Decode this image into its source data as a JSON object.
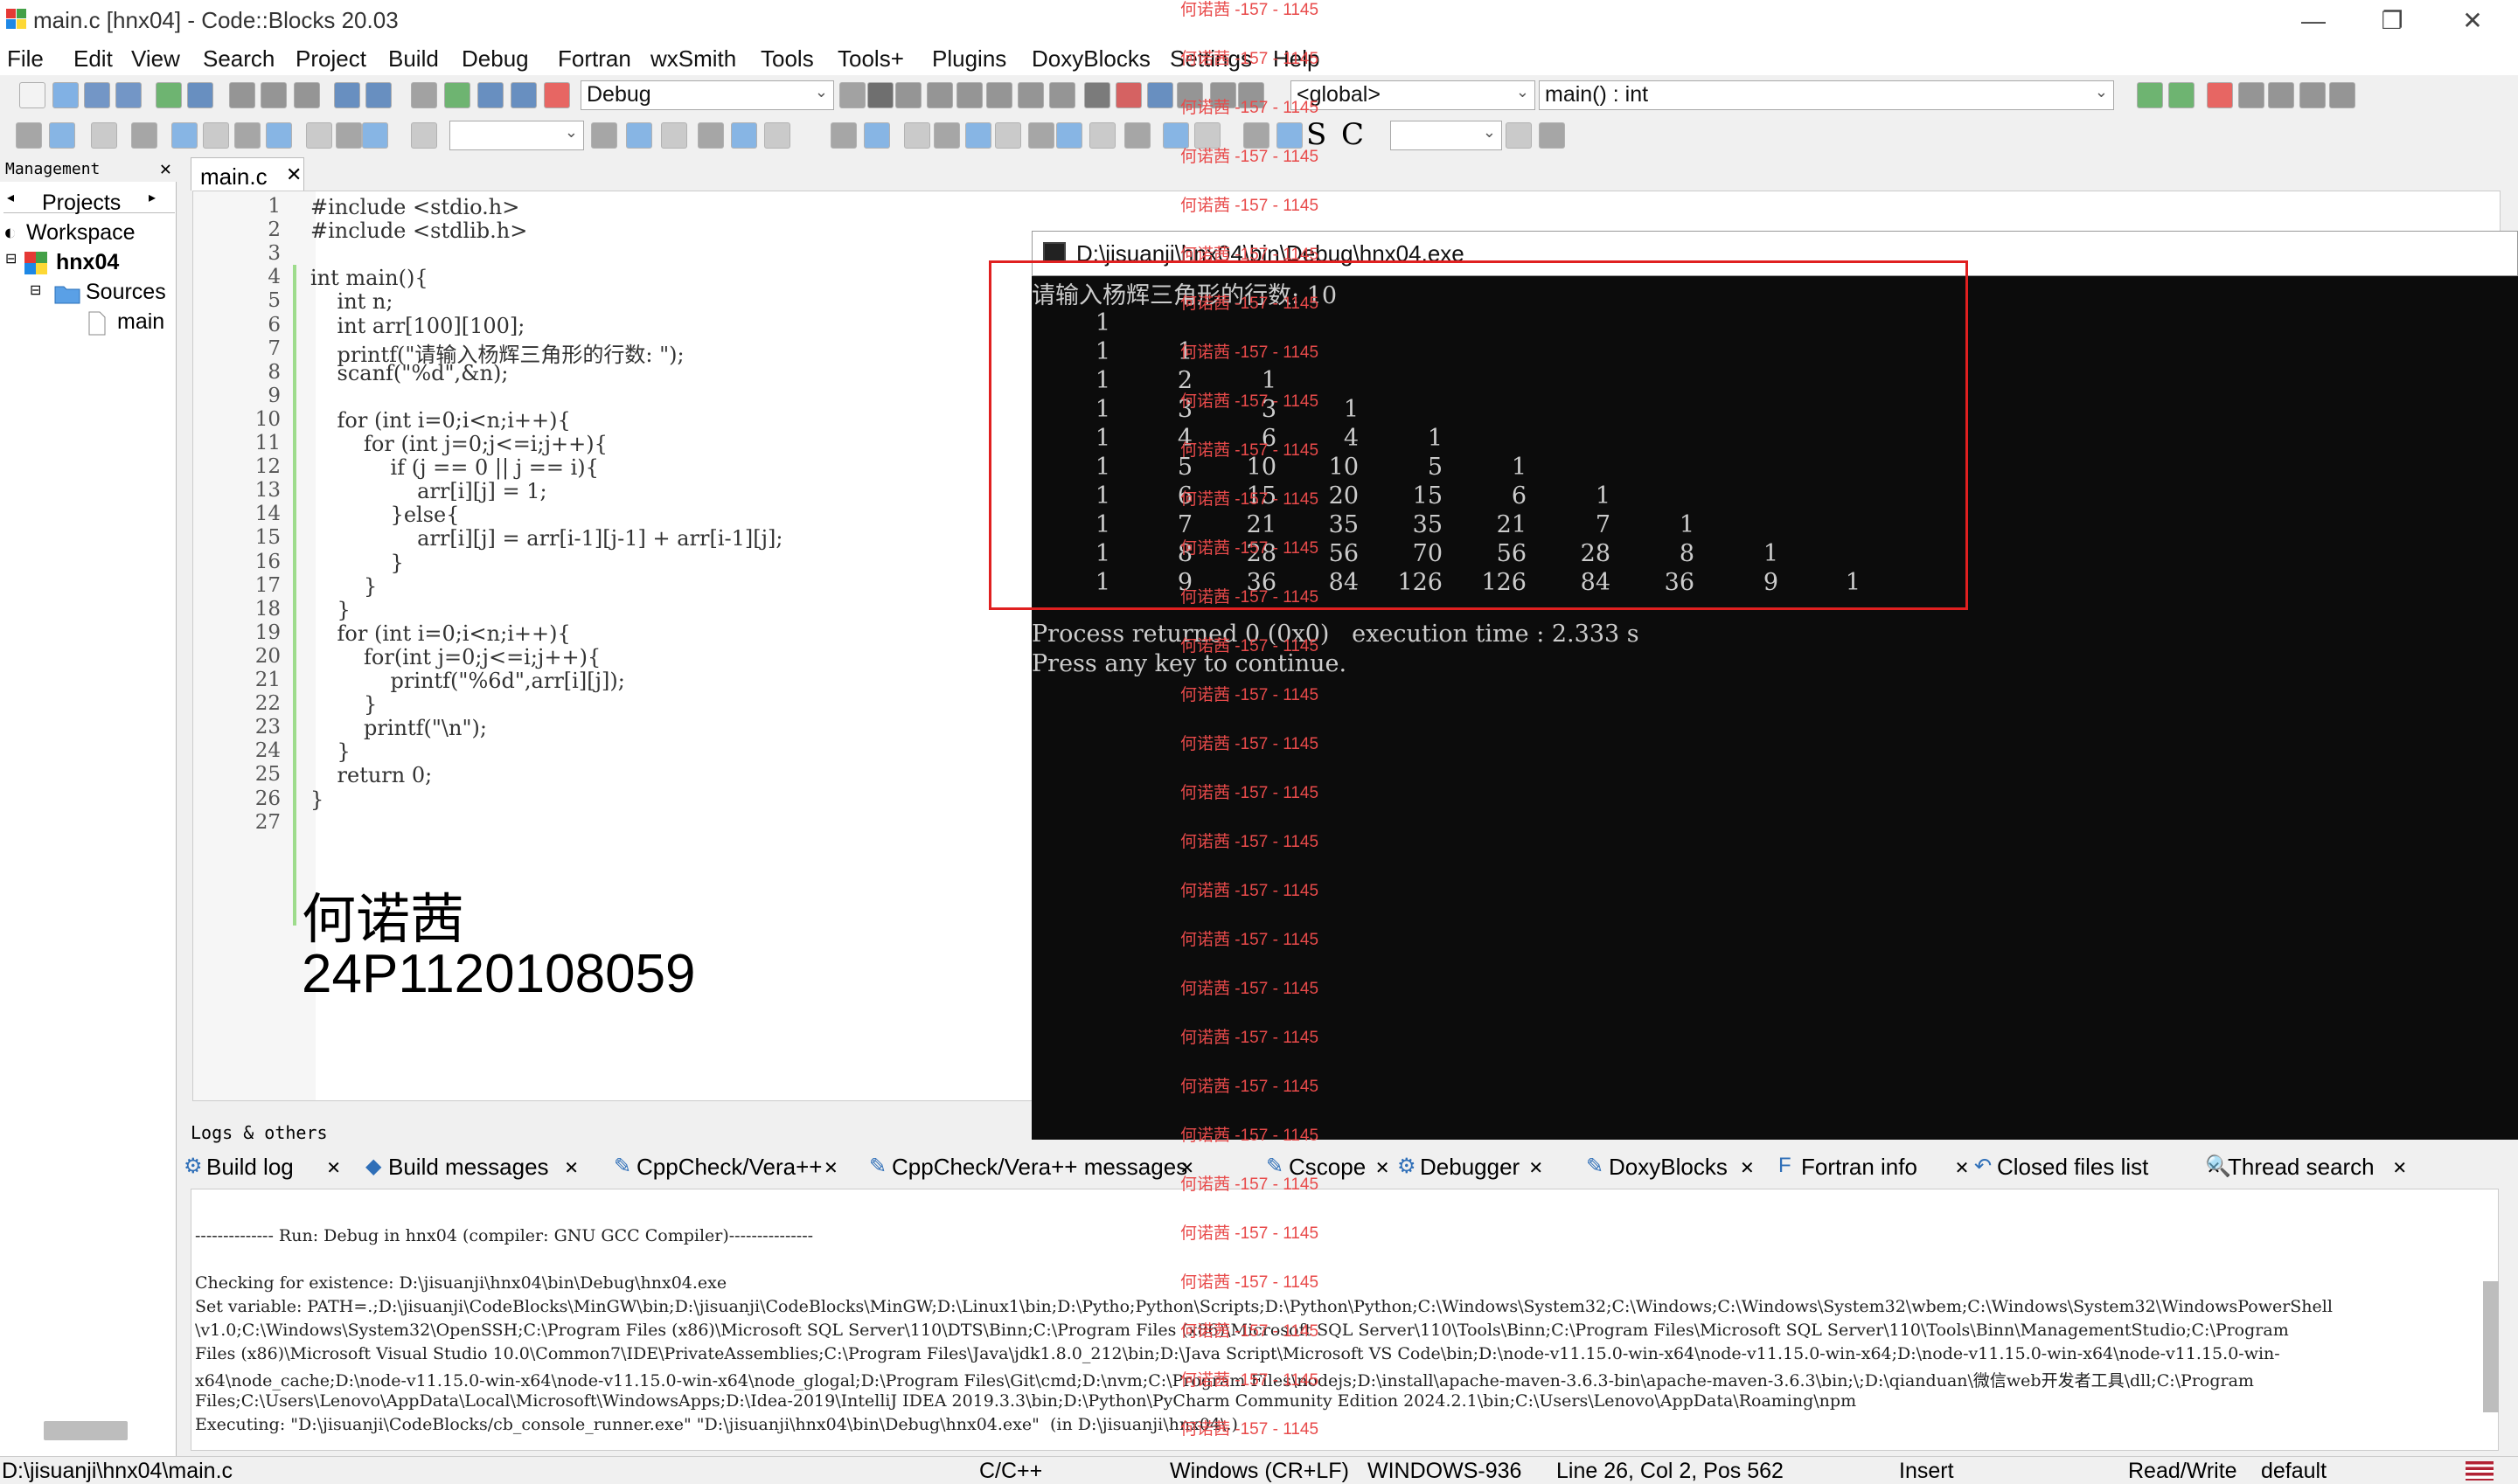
{
  "window": {
    "title": "main.c [hnx04] - Code::Blocks 20.03"
  },
  "menu": [
    "File",
    "Edit",
    "View",
    "Search",
    "Project",
    "Build",
    "Debug",
    "Fortran",
    "wxSmith",
    "Tools",
    "Tools+",
    "Plugins",
    "DoxyBlocks",
    "Settings",
    "Help"
  ],
  "toolbar": {
    "build_target": "Debug",
    "scope": "<global>",
    "function": "main() : int",
    "s_letter": "S",
    "c_letter": "C"
  },
  "management": {
    "header": "Management",
    "tab_projects": "Projects",
    "workspace": "Workspace",
    "project": "hnx04",
    "sources": "Sources",
    "file": "main"
  },
  "editor": {
    "tab": "main.c",
    "lines": [
      "#include <stdio.h>",
      "#include <stdlib.h>",
      "",
      "int main(){",
      "    int n;",
      "    int arr[100][100];",
      "    printf(\"请输入杨辉三角形的行数: \");",
      "    scanf(\"%d\",&n);",
      "",
      "    for (int i=0;i<n;i++){",
      "        for (int j=0;j<=i;j++){",
      "            if (j == 0 || j == i){",
      "                arr[i][j] = 1;",
      "            }else{",
      "                arr[i][j] = arr[i-1][j-1] + arr[i-1][j];",
      "            }",
      "        }",
      "    }",
      "    for (int i=0;i<n;i++){",
      "        for(int j=0;j<=i;j++){",
      "            printf(\"%6d\",arr[i][j]);",
      "        }",
      "        printf(\"\\n\");",
      "    }",
      "    return 0;",
      "}",
      ""
    ],
    "overlay_name": "何诺茜",
    "overlay_id": "24P1120108059"
  },
  "console": {
    "title": "D:\\jisuanji\\hnx04\\bin\\Debug\\hnx04.exe",
    "prompt": "请输入杨辉三角形的行数: 10",
    "triangle": [
      [
        1
      ],
      [
        1,
        1
      ],
      [
        1,
        2,
        1
      ],
      [
        1,
        3,
        3,
        1
      ],
      [
        1,
        4,
        6,
        4,
        1
      ],
      [
        1,
        5,
        10,
        10,
        5,
        1
      ],
      [
        1,
        6,
        15,
        20,
        15,
        6,
        1
      ],
      [
        1,
        7,
        21,
        35,
        35,
        21,
        7,
        1
      ],
      [
        1,
        8,
        28,
        56,
        70,
        56,
        28,
        8,
        1
      ],
      [
        1,
        9,
        36,
        84,
        126,
        126,
        84,
        36,
        9,
        1
      ]
    ],
    "process_line": "Process returned 0 (0x0)   execution time : 2.333 s",
    "press_line": "Press any key to continue."
  },
  "logs": {
    "header": "Logs & others",
    "tabs": [
      "Build log",
      "Build messages",
      "CppCheck/Vera++",
      "CppCheck/Vera++ messages",
      "Cscope",
      "Debugger",
      "DoxyBlocks",
      "Fortran info",
      "Closed files list",
      "Thread search"
    ],
    "lines": [
      "-------------- Run: Debug in hnx04 (compiler: GNU GCC Compiler)---------------",
      "",
      "Checking for existence: D:\\jisuanji\\hnx04\\bin\\Debug\\hnx04.exe",
      "Set variable: PATH=.;D:\\jisuanji\\CodeBlocks\\MinGW\\bin;D:\\jisuanji\\CodeBlocks\\MinGW;D:\\Linux1\\bin;D:\\Pytho;Python\\Scripts;D:\\Python\\Python;C:\\Windows\\System32;C:\\Windows;C:\\Windows\\System32\\wbem;C:\\Windows\\System32\\WindowsPowerShell",
      "\\v1.0;C:\\Windows\\System32\\OpenSSH;C:\\Program Files (x86)\\Microsoft SQL Server\\110\\DTS\\Binn;C:\\Program Files (x86)\\Microsoft SQL Server\\110\\Tools\\Binn;C:\\Program Files\\Microsoft SQL Server\\110\\Tools\\Binn\\ManagementStudio;C:\\Program",
      "Files (x86)\\Microsoft Visual Studio 10.0\\Common7\\IDE\\PrivateAssemblies;C:\\Program Files\\Java\\jdk1.8.0_212\\bin;D:\\Java Script\\Microsoft VS Code\\bin;D:\\node-v11.15.0-win-x64\\node-v11.15.0-win-x64;D:\\node-v11.15.0-win-x64\\node-v11.15.0-win-",
      "x64\\node_cache;D:\\node-v11.15.0-win-x64\\node-v11.15.0-win-x64\\node_glogal;D:\\Program Files\\Git\\cmd;D:\\nvm;C:\\Program Files\\nodejs;D:\\install\\apache-maven-3.6.3-bin\\apache-maven-3.6.3\\bin;\\;D:\\qianduan\\微信web开发者工具\\dll;C:\\Program",
      "Files;C:\\Users\\Lenovo\\AppData\\Local\\Microsoft\\WindowsApps;D:\\Idea-2019\\IntelliJ IDEA 2019.3.3\\bin;D:\\Python\\PyCharm Community Edition 2024.2.1\\bin;C:\\Users\\Lenovo\\AppData\\Roaming\\npm",
      "Executing: \"D:\\jisuanji\\CodeBlocks/cb_console_runner.exe\" \"D:\\jisuanji\\hnx04\\bin\\Debug\\hnx04.exe\"  (in D:\\jisuanji\\hnx04\\.)"
    ]
  },
  "status": {
    "path": "D:\\jisuanji\\hnx04\\main.c",
    "lang": "C/C++",
    "eol": "Windows (CR+LF)",
    "encoding": "WINDOWS-936",
    "position": "Line 26, Col 2, Pos 562",
    "mode": "Insert",
    "access": "Read/Write",
    "profile": "default"
  },
  "watermark": "何诺茜 -157 - 1145"
}
